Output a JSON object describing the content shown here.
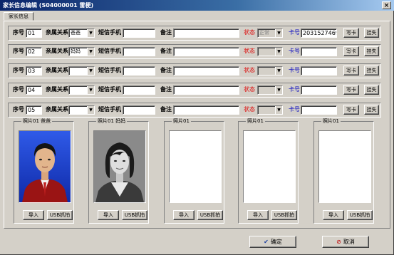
{
  "window": {
    "title": "家长信息编辑 (S04000001 雷梗)",
    "close_glyph": "×"
  },
  "tab": {
    "label": "家长信息"
  },
  "labels": {
    "seq": "序号",
    "relation": "亲属关系",
    "sms_phone": "短信手机",
    "note": "备注",
    "status": "状态",
    "card": "卡号",
    "write_card": "写卡",
    "report_loss": "挂失"
  },
  "rows": [
    {
      "seq": "01",
      "relation": "爸爸",
      "sms_phone": "",
      "note": "",
      "status": "正常",
      "card": "2031527469"
    },
    {
      "seq": "02",
      "relation": "妈妈",
      "sms_phone": "",
      "note": "",
      "status": "",
      "card": ""
    },
    {
      "seq": "03",
      "relation": "",
      "sms_phone": "",
      "note": "",
      "status": "",
      "card": ""
    },
    {
      "seq": "04",
      "relation": "",
      "sms_phone": "",
      "note": "",
      "status": "",
      "card": ""
    },
    {
      "seq": "05",
      "relation": "",
      "sms_phone": "",
      "note": "",
      "status": "",
      "card": ""
    }
  ],
  "photos": [
    {
      "title": "照片01 爸爸",
      "has_photo": true,
      "style": "color-man"
    },
    {
      "title": "照片01 妈妈",
      "has_photo": true,
      "style": "bw-woman"
    },
    {
      "title": "照片01",
      "has_photo": false
    },
    {
      "title": "照片01",
      "has_photo": false
    },
    {
      "title": "照片01",
      "has_photo": false
    }
  ],
  "photo_buttons": {
    "import": "导入",
    "usb_capture": "USB抓拍"
  },
  "footer": {
    "ok": "确定",
    "cancel": "取消"
  },
  "colors": {
    "title_start": "#0a246a",
    "status_label": "#dd0000",
    "card_label": "#0000c0",
    "photo_bg_blue": "#1c3fd0"
  },
  "icons": {
    "ok": "check-icon",
    "cancel": "cancel-icon",
    "dropdown": "chevron-down-icon",
    "close": "close-icon"
  }
}
